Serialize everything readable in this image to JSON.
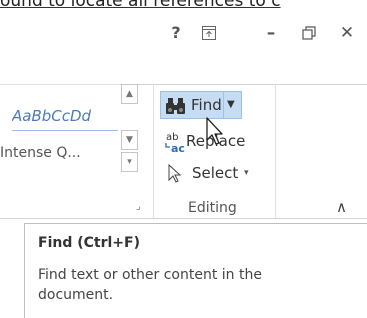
{
  "document": {
    "visible_text": "ound to locate all references to c"
  },
  "window_controls": {
    "help": "?",
    "ribbon_display": "⊼",
    "minimize": "–",
    "restore": "🗗",
    "close": "✕"
  },
  "styles_gallery": {
    "items": [
      {
        "label": "AaBbCcDd"
      },
      {
        "label": "Intense Q..."
      }
    ],
    "scroll_up": "▲",
    "scroll_down": "▼",
    "more": "▾",
    "dialog_launcher": "⌟"
  },
  "editing_group": {
    "find_label": "Find",
    "find_dropdown": "▼",
    "replace_label": "Replace",
    "select_label": "Select",
    "select_dropdown": "▾",
    "group_label": "Editing",
    "collapse": "∧"
  },
  "tooltip": {
    "title": "Find (Ctrl+F)",
    "description": "Find text or other content in the document."
  },
  "colors": {
    "find_highlight": "#c5dcf3",
    "style_accent": "#4a7bb7"
  }
}
